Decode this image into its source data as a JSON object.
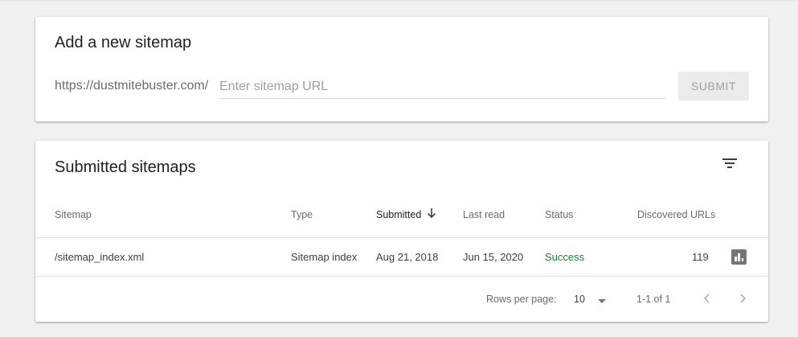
{
  "add_sitemap": {
    "title": "Add a new sitemap",
    "url_prefix": "https://dustmitebuster.com/",
    "input_placeholder": "Enter sitemap URL",
    "input_value": "",
    "submit_label": "SUBMIT"
  },
  "submitted": {
    "title": "Submitted sitemaps",
    "filter_icon": "filter-icon",
    "columns": {
      "sitemap": "Sitemap",
      "type": "Type",
      "submitted": "Submitted",
      "last_read": "Last read",
      "status": "Status",
      "discovered_urls": "Discovered URLs"
    },
    "sort": {
      "column": "submitted",
      "direction": "descending",
      "icon": "arrow-down-icon"
    },
    "rows": [
      {
        "sitemap": "/sitemap_index.xml",
        "type": "Sitemap index",
        "submitted": "Aug 21, 2018",
        "last_read": "Jun 15, 2020",
        "status": "Success",
        "discovered_urls": "119",
        "action_icon": "bar-chart-icon"
      }
    ],
    "pagination": {
      "rows_per_page_label": "Rows per page:",
      "rows_per_page_value": "10",
      "range": "1-1 of 1",
      "prev_icon": "chevron-left-icon",
      "next_icon": "chevron-right-icon"
    }
  },
  "colors": {
    "background": "#f1f1f1",
    "card": "#ffffff",
    "status_success": "#188038",
    "submit_disabled_bg": "#ebebeb",
    "submit_disabled_text": "#9e9e9e"
  }
}
